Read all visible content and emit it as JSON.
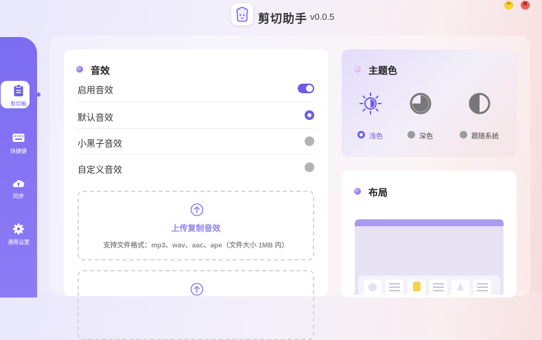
{
  "app": {
    "title": "剪切助手",
    "version": "v0.0.5"
  },
  "window_controls": {
    "minimize_symbol": "–",
    "close_symbol": "×"
  },
  "sidebar": {
    "items": [
      {
        "label": "剪切板",
        "icon": "clipboard-icon",
        "active": true
      },
      {
        "label": "快捷键",
        "icon": "keyboard-icon",
        "active": false
      },
      {
        "label": "同步",
        "icon": "cloud-upload-icon",
        "active": false
      },
      {
        "label": "通用设置",
        "icon": "gear-icon",
        "active": false
      }
    ]
  },
  "sound": {
    "title": "音效",
    "enable_label": "启用音效",
    "enable_on": true,
    "options": [
      {
        "label": "默认音效",
        "selected": true
      },
      {
        "label": "小黑子音效",
        "selected": false
      },
      {
        "label": "自定义音效",
        "selected": false
      }
    ],
    "upload": {
      "title": "上传复制音效",
      "hint": "支持文件格式：mp3、wav、aac、ape（文件大小 1MB 内）"
    }
  },
  "theme": {
    "title": "主题色",
    "options": [
      {
        "label": "浅色",
        "icon": "sun-icon",
        "selected": true
      },
      {
        "label": "深色",
        "icon": "moon-pie-icon",
        "selected": false
      },
      {
        "label": "跟随系统",
        "icon": "half-circle-icon",
        "selected": false
      }
    ]
  },
  "layout": {
    "title": "布局"
  },
  "colors": {
    "accent": "#6c5ce7",
    "sidebar": "#7c6cf2",
    "upload_text": "#8f86e8",
    "inactive_radio": "#b3b3b3"
  }
}
